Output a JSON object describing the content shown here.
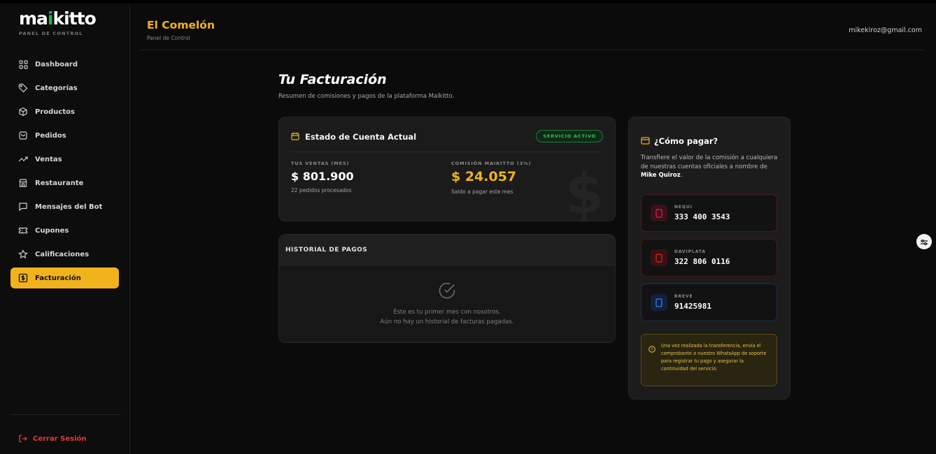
{
  "brand": {
    "logo_prefix": "ma",
    "logo_accent": "i",
    "logo_suffix": "kitto",
    "subtitle": "PANEL DE CONTROL",
    "accent_color": "#f1b31c",
    "logo_green": "#22b04a"
  },
  "sidebar": {
    "items": [
      {
        "label": "Dashboard",
        "icon": "grid-icon"
      },
      {
        "label": "Categorías",
        "icon": "tag-icon"
      },
      {
        "label": "Productos",
        "icon": "box-icon"
      },
      {
        "label": "Pedidos",
        "icon": "bag-icon"
      },
      {
        "label": "Ventas",
        "icon": "trend-icon"
      },
      {
        "label": "Restaurante",
        "icon": "store-icon"
      },
      {
        "label": "Mensajes del Bot",
        "icon": "message-icon"
      },
      {
        "label": "Cupones",
        "icon": "ticket-icon"
      },
      {
        "label": "Calificaciones",
        "icon": "star-icon"
      },
      {
        "label": "Facturación",
        "icon": "dollar-icon",
        "active": true
      }
    ],
    "logout_label": "Cerrar Sesión"
  },
  "header": {
    "restaurant_name": "El Comelón",
    "subtitle": "Panel de Control",
    "user_email": "mikekiroz@gmail.com"
  },
  "main": {
    "title": "Tu Facturación",
    "subtitle": "Resumen de comisiones y pagos de la plataforma Maikitto.",
    "account": {
      "title": "Estado de Cuenta Actual",
      "status_badge": "SERVICIO ACTIVO",
      "sales_caption": "TUS VENTAS (MES)",
      "sales_value": "$ 801.900",
      "sales_note": "22 pedidos procesados",
      "commission_caption": "COMISIÓN MAIKITTO (3%)",
      "commission_value": "$ 24.057",
      "commission_note": "Saldo a pagar este mes",
      "watermark": "$"
    },
    "history": {
      "title": "HISTORIAL DE PAGOS",
      "empty_line1": "Este es tu primer mes con nosotros.",
      "empty_line2": "Aún no hay un historial de facturas pagadas."
    },
    "payment": {
      "title": "¿Cómo pagar?",
      "desc_prefix": "Transfiere el valor de la comisión a cualquiera de nuestras cuentas oficiales a nombre de ",
      "desc_name": "Mike Quiroz",
      "desc_suffix": ".",
      "accounts": [
        {
          "name": "NEQUI",
          "number": "333 400 3543",
          "color": "#e0224a"
        },
        {
          "name": "DAVIPLATA",
          "number": "322 806 0116",
          "color": "#e02020"
        },
        {
          "name": "BREVE",
          "number": "91425981",
          "color": "#3b82f6"
        }
      ],
      "notice": "Una vez realizada la transferencia, envía el comprobante a nuestro WhatsApp de soporte para registrar tu pago y asegurar la continuidad del servicio."
    }
  }
}
